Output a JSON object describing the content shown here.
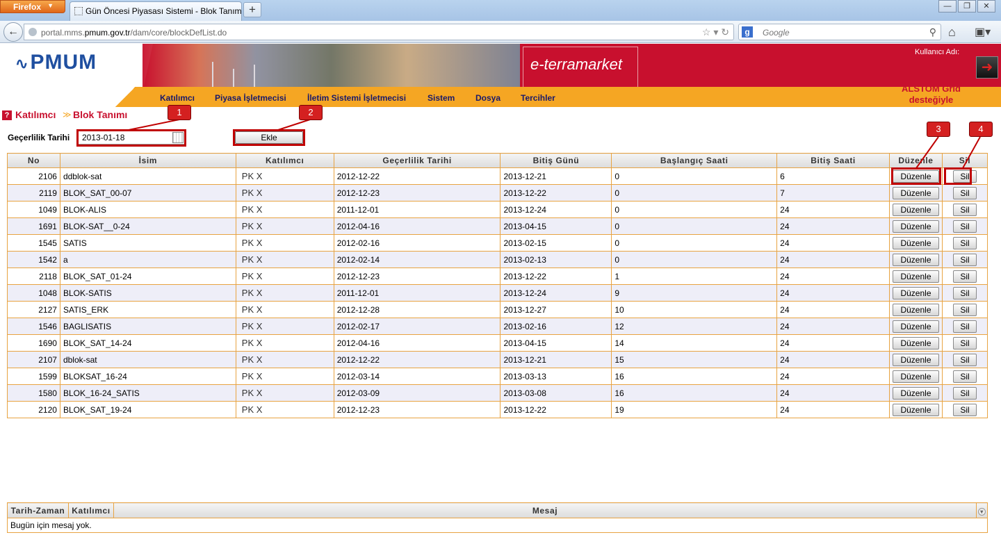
{
  "browser": {
    "menu_label": "Firefox",
    "tab_title": "Gün Öncesi Piyasası Sistemi - Blok Tanımı",
    "url_prefix": "portal.mms.",
    "url_domain": "pmum.gov.tr",
    "url_path": "/dam/core/blockDefList.do",
    "search_placeholder": "Google"
  },
  "header": {
    "logo_text": "PMUM",
    "brand_text": "e-terramarket",
    "user_label": "Kullanıcı Adı:",
    "sponsor_line1": "ALSTOM Grid",
    "sponsor_line2": "desteğiyle",
    "menu": [
      "Katılımcı",
      "Piyasa İşletmecisi",
      "İletim Sistemi İşletmecisi",
      "Sistem",
      "Dosya",
      "Tercihler"
    ]
  },
  "breadcrumb": {
    "parent": "Katılımcı",
    "current": "Blok Tanımı"
  },
  "form": {
    "date_label": "Geçerlilik Tarihi",
    "date_value": "2013-01-18",
    "add_button": "Ekle"
  },
  "callouts": [
    "1",
    "2",
    "3",
    "4"
  ],
  "table": {
    "headers": [
      "No",
      "İsim",
      "Katılımcı",
      "Geçerlilik Tarihi",
      "Bitiş Günü",
      "Başlangıç Saati",
      "Bitiş Saati",
      "Düzenle",
      "Sil"
    ],
    "edit_label": "Düzenle",
    "delete_label": "Sil",
    "rows": [
      {
        "no": "2106",
        "name": "ddblok-sat",
        "participant": "PK X",
        "valid_from": "2012-12-22",
        "end_day": "2013-12-21",
        "start_hour": "0",
        "end_hour": "6"
      },
      {
        "no": "2119",
        "name": "BLOK_SAT_00-07",
        "participant": "PK X",
        "valid_from": "2012-12-23",
        "end_day": "2013-12-22",
        "start_hour": "0",
        "end_hour": "7"
      },
      {
        "no": "1049",
        "name": "BLOK-ALIS",
        "participant": "PK X",
        "valid_from": "2011-12-01",
        "end_day": "2013-12-24",
        "start_hour": "0",
        "end_hour": "24"
      },
      {
        "no": "1691",
        "name": "BLOK-SAT__0-24",
        "participant": "PK X",
        "valid_from": "2012-04-16",
        "end_day": "2013-04-15",
        "start_hour": "0",
        "end_hour": "24"
      },
      {
        "no": "1545",
        "name": "SATIS",
        "participant": "PK X",
        "valid_from": "2012-02-16",
        "end_day": "2013-02-15",
        "start_hour": "0",
        "end_hour": "24"
      },
      {
        "no": "1542",
        "name": "a",
        "participant": "PK X",
        "valid_from": "2012-02-14",
        "end_day": "2013-02-13",
        "start_hour": "0",
        "end_hour": "24"
      },
      {
        "no": "2118",
        "name": "BLOK_SAT_01-24",
        "participant": "PK X",
        "valid_from": "2012-12-23",
        "end_day": "2013-12-22",
        "start_hour": "1",
        "end_hour": "24"
      },
      {
        "no": "1048",
        "name": "BLOK-SATIS",
        "participant": "PK X",
        "valid_from": "2011-12-01",
        "end_day": "2013-12-24",
        "start_hour": "9",
        "end_hour": "24"
      },
      {
        "no": "2127",
        "name": "SATIS_ERK",
        "participant": "PK X",
        "valid_from": "2012-12-28",
        "end_day": "2013-12-27",
        "start_hour": "10",
        "end_hour": "24"
      },
      {
        "no": "1546",
        "name": "BAGLISATIS",
        "participant": "PK X",
        "valid_from": "2012-02-17",
        "end_day": "2013-02-16",
        "start_hour": "12",
        "end_hour": "24"
      },
      {
        "no": "1690",
        "name": "BLOK_SAT_14-24",
        "participant": "PK X",
        "valid_from": "2012-04-16",
        "end_day": "2013-04-15",
        "start_hour": "14",
        "end_hour": "24"
      },
      {
        "no": "2107",
        "name": "dblok-sat",
        "participant": "PK X",
        "valid_from": "2012-12-22",
        "end_day": "2013-12-21",
        "start_hour": "15",
        "end_hour": "24"
      },
      {
        "no": "1599",
        "name": "BLOKSAT_16-24",
        "participant": "PK X",
        "valid_from": "2012-03-14",
        "end_day": "2013-03-13",
        "start_hour": "16",
        "end_hour": "24"
      },
      {
        "no": "1580",
        "name": "BLOK_16-24_SATIS",
        "participant": "PK X",
        "valid_from": "2012-03-09",
        "end_day": "2013-03-08",
        "start_hour": "16",
        "end_hour": "24"
      },
      {
        "no": "2120",
        "name": "BLOK_SAT_19-24",
        "participant": "PK X",
        "valid_from": "2012-12-23",
        "end_day": "2013-12-22",
        "start_hour": "19",
        "end_hour": "24"
      }
    ]
  },
  "messages": {
    "headers": [
      "Tarih-Zaman",
      "Katılımcı",
      "Mesaj"
    ],
    "empty_text": "Bugün için mesaj yok."
  },
  "colors": {
    "brand_red": "#c8102e",
    "menu_orange": "#f5a623",
    "border_orange": "#e8a341",
    "callout_red": "#d42020"
  }
}
